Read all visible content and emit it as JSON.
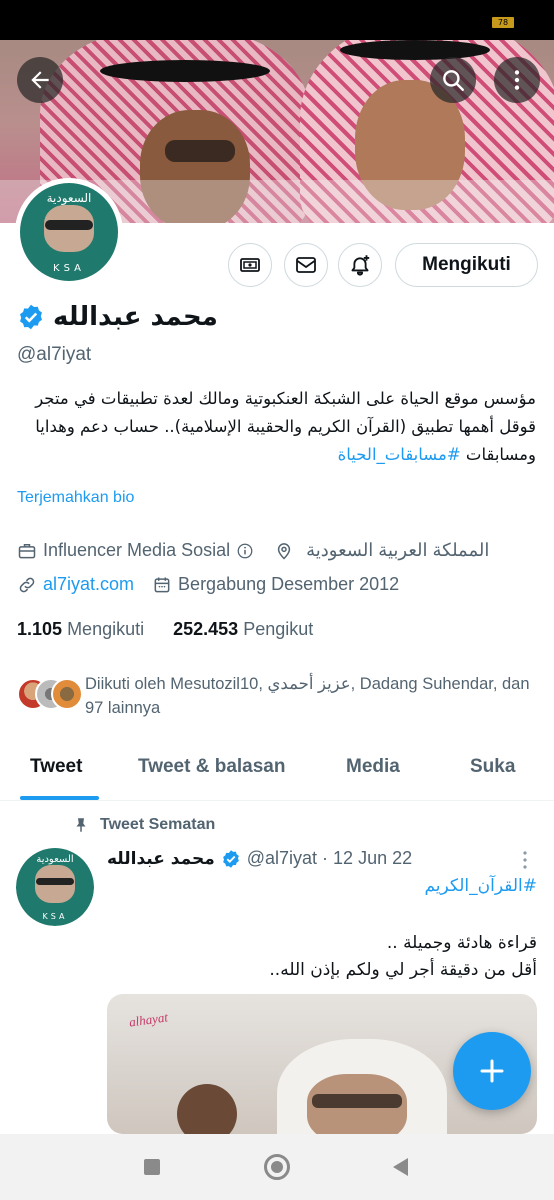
{
  "status_bar": {
    "battery": "78"
  },
  "header": {
    "back_icon": "arrow-left-icon",
    "search_icon": "search-icon",
    "more_icon": "more-vertical-icon"
  },
  "profile": {
    "avatar_top_text": "السعودية",
    "avatar_bottom_text": "KSA",
    "display_name": "محمد عبدالله",
    "verified": true,
    "handle": "@al7iyat",
    "bio": {
      "text": "مؤسس موقع الحياة على الشبكة العنكبوتية ومالك لعدة تطبيقات في متجر قوقل أهمها تطبيق (القرآن الكريم والحقيبة الإسلامية).. حساب دعم وهدايا ومسابقات ",
      "hashtag": "#مسابقات_الحياة"
    },
    "translate_label": "Terjemahkan bio",
    "category": "Influencer Media Sosial",
    "location": "المملكة العربية السعودية",
    "website": "al7iyat.com",
    "joined": "Bergabung Desember 2012",
    "following_count": "1.105",
    "following_label": "Mengikuti",
    "followers_count": "252.453",
    "followers_label": "Pengikut",
    "followed_by": "Diikuti oleh Mesutozil10, عزيز أحمدي, Dadang Suhendar, dan 97 lainnya"
  },
  "actions": {
    "follow_label": "Mengikuti",
    "tip_icon": "money-icon",
    "message_icon": "envelope-icon",
    "notify_icon": "bell-plus-icon"
  },
  "tabs": [
    {
      "label": "Tweet",
      "active": true
    },
    {
      "label": "Tweet & balasan",
      "active": false
    },
    {
      "label": "Media",
      "active": false
    },
    {
      "label": "Suka",
      "active": false
    }
  ],
  "pinned_tweet": {
    "pinned_label": "Tweet Sematan",
    "author_name": "محمد عبدالله",
    "verified": true,
    "meta": "@al7iyat · 12 Jun 22",
    "hashtag": "#القرآن_الكريم",
    "text_line1": "قراءة هادئة وجميلة ..",
    "text_line2": "أقل من دقيقة أجر لي ولكم بإذن الله..",
    "media_watermark": "alhayat"
  },
  "colors": {
    "accent": "#1d9bf0",
    "text_primary": "#0f1419",
    "text_secondary": "#536471",
    "border": "#cfd9de"
  }
}
